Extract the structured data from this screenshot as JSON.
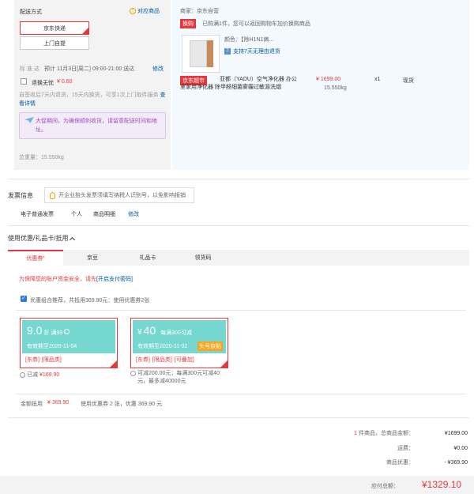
{
  "shipping": {
    "title": "配送方式",
    "matched_label": "对应商品",
    "options": [
      "京东快递",
      "上门自提"
    ],
    "standard_label": "标 准 达",
    "standard_time": "预计 11月3日[周二] 09:00-21:00 送达",
    "modify": "修改",
    "no_return_label": "退换无忧",
    "no_return_price": "¥ 0.60",
    "no_return_desc": "自签收后7天内退货，15天内换货，可享1次上门取件服务",
    "detail_link": "查看详情",
    "notice": "大促期间，为确保顺利收货，请留意配送时间和地址。",
    "total_weight": "总重量：15.550kg"
  },
  "order": {
    "seller": "商家：京东自营",
    "promo_tag": "换购",
    "promo_text": "已购满1件，您可以返回购物车加价换购商品",
    "color_label": "颜色：【除H1N1病...",
    "return_badge": "支持7天无理由退货",
    "badge": "京东超市",
    "product_name": "亚都（YADU）空气净化器 办公室家用净化器 除甲醛细菌雾霾过敏源洗烟",
    "price": "¥ 1699.00",
    "qty": "x1",
    "stock": "现货",
    "weight": "15.550kg"
  },
  "invoice": {
    "title": "发票信息",
    "tip": "开企业抬头发票须填写纳税人识别号，以免影响报销",
    "type": "电子普通发票",
    "person": "个人",
    "detail": "商品明细",
    "modify": "修改"
  },
  "discount": {
    "title": "使用优惠/礼品卡/抵用",
    "tabs": [
      "优惠券",
      "京豆",
      "礼品卡",
      "领货码"
    ],
    "security_text": "为保障您的账户资金安全，请先",
    "security_link": "[开启支付密码]",
    "combo_text": "优惠组合推荐，共抵用369.90元：使用优惠券2张",
    "coupon1": {
      "value": "9.0",
      "unit": "折",
      "cond": "满99",
      "expire": "有效期至2020-11-04",
      "tags": [
        "[东券]",
        "[限品类]"
      ],
      "note_prefix": "已减",
      "note_value": "¥169.90"
    },
    "coupon2": {
      "currency": "¥",
      "value": "40",
      "cond": "每满300可减",
      "expire": "有效期至2020-11-02",
      "tag_badge": "头号京贴",
      "tags": [
        "[东券]",
        "[限品类]",
        "[可叠加]"
      ],
      "note": "可减200.00元；每满300元可减40元，最多减40000元"
    },
    "summary_label": "金额抵用",
    "summary_value": "¥ 369.90",
    "summary_text": "使用优惠券 2 张，优惠 369.90 元"
  },
  "totals": {
    "count_num": "1",
    "count_label": "件商品，总商品金额：",
    "goods_value": "¥1699.00",
    "freight_label": "运费：",
    "freight_value": "¥0.00",
    "discount_label": "商品优惠：",
    "discount_value": "- ¥369.90",
    "payable_label": "应付总额：",
    "payable_value": "¥1329.10"
  }
}
